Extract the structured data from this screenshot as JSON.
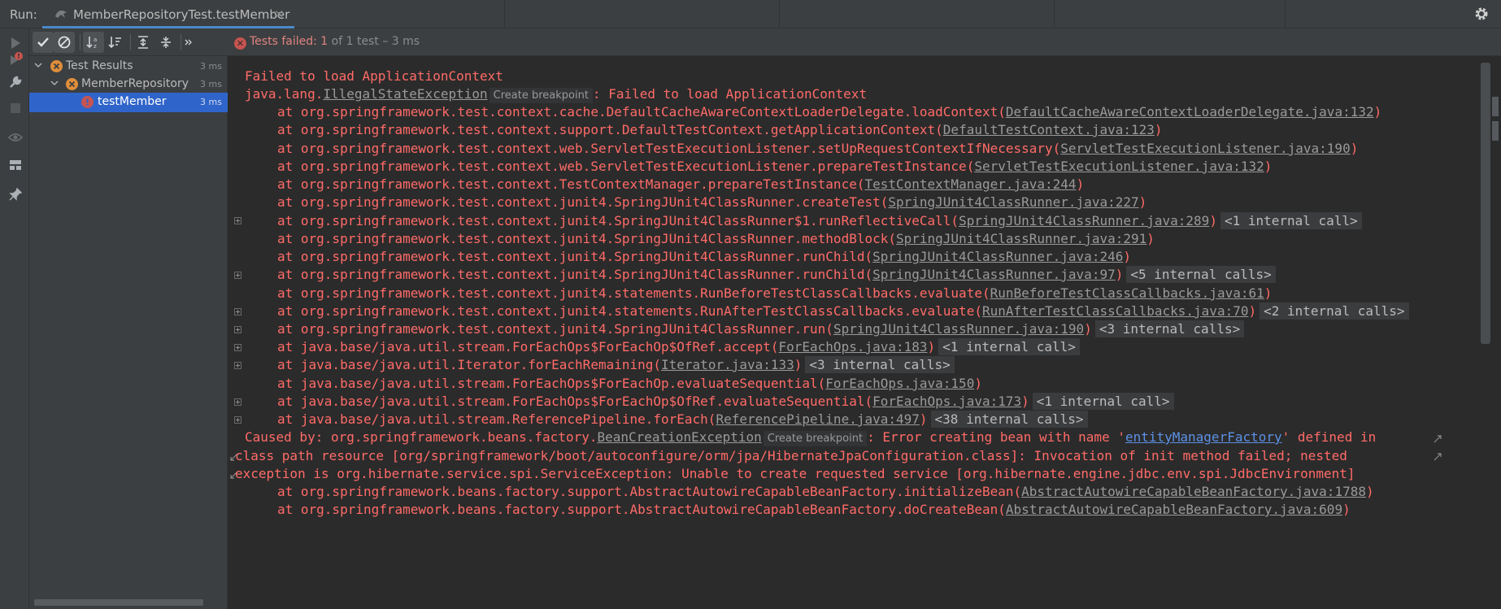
{
  "window": {
    "run_label": "Run:",
    "tab_title": "MemberRepositoryTest.testMember",
    "tab_close": "×"
  },
  "status": {
    "failed_text": "Tests failed:",
    "failed_count": "1",
    "rest": "of 1 test – 3 ms"
  },
  "tree": {
    "items": [
      {
        "label": "Test Results",
        "time": "3 ms"
      },
      {
        "label": "MemberRepository",
        "time": "3 ms"
      },
      {
        "label": "testMember",
        "time": "3 ms"
      }
    ]
  },
  "console": {
    "chip_breakpoint": "Create breakpoint",
    "lines": [
      {
        "text": "Failed to load ApplicationContext"
      },
      {
        "pre": "java.lang.",
        "link": "IllegalStateException",
        "post": ": Failed to load ApplicationContext"
      },
      {
        "pre": "at org.springframework.test.context.cache.DefaultCacheAwareContextLoaderDelegate.loadContext(",
        "link": "DefaultCacheAwareContextLoaderDelegate.java:132",
        "post": ")"
      },
      {
        "pre": "at org.springframework.test.context.support.DefaultTestContext.getApplicationContext(",
        "link": "DefaultTestContext.java:123",
        "post": ")"
      },
      {
        "pre": "at org.springframework.test.context.web.ServletTestExecutionListener.setUpRequestContextIfNecessary(",
        "link": "ServletTestExecutionListener.java:190",
        "post": ")"
      },
      {
        "pre": "at org.springframework.test.context.web.ServletTestExecutionListener.prepareTestInstance(",
        "link": "ServletTestExecutionListener.java:132",
        "post": ")"
      },
      {
        "pre": "at org.springframework.test.context.TestContextManager.prepareTestInstance(",
        "link": "TestContextManager.java:244",
        "post": ")"
      },
      {
        "pre": "at org.springframework.test.context.junit4.SpringJUnit4ClassRunner.createTest(",
        "link": "SpringJUnit4ClassRunner.java:227",
        "post": ")"
      },
      {
        "pre": "at org.springframework.test.context.junit4.SpringJUnit4ClassRunner$1.runReflectiveCall(",
        "link": "SpringJUnit4ClassRunner.java:289",
        "post": ")",
        "internal": "<1 internal call>"
      },
      {
        "pre": "at org.springframework.test.context.junit4.SpringJUnit4ClassRunner.methodBlock(",
        "link": "SpringJUnit4ClassRunner.java:291",
        "post": ")"
      },
      {
        "pre": "at org.springframework.test.context.junit4.SpringJUnit4ClassRunner.runChild(",
        "link": "SpringJUnit4ClassRunner.java:246",
        "post": ")"
      },
      {
        "pre": "at org.springframework.test.context.junit4.SpringJUnit4ClassRunner.runChild(",
        "link": "SpringJUnit4ClassRunner.java:97",
        "post": ")",
        "internal": "<5 internal calls>"
      },
      {
        "pre": "at org.springframework.test.context.junit4.statements.RunBeforeTestClassCallbacks.evaluate(",
        "link": "RunBeforeTestClassCallbacks.java:61",
        "post": ")"
      },
      {
        "pre": "at org.springframework.test.context.junit4.statements.RunAfterTestClassCallbacks.evaluate(",
        "link": "RunAfterTestClassCallbacks.java:70",
        "post": ")",
        "internal": "<2 internal calls>"
      },
      {
        "pre": "at org.springframework.test.context.junit4.SpringJUnit4ClassRunner.run(",
        "link": "SpringJUnit4ClassRunner.java:190",
        "post": ")",
        "internal": "<3 internal calls>"
      },
      {
        "pre": "at java.base/java.util.stream.ForEachOps$ForEachOp$OfRef.accept(",
        "link": "ForEachOps.java:183",
        "post": ")",
        "internal": "<1 internal call>"
      },
      {
        "pre": "at java.base/java.util.Iterator.forEachRemaining(",
        "link": "Iterator.java:133",
        "post": ")",
        "internal": "<3 internal calls>"
      },
      {
        "pre": "at java.base/java.util.stream.ForEachOps$ForEachOp.evaluateSequential(",
        "link": "ForEachOps.java:150",
        "post": ")"
      },
      {
        "pre": "at java.base/java.util.stream.ForEachOps$ForEachOp$OfRef.evaluateSequential(",
        "link": "ForEachOps.java:173",
        "post": ")",
        "internal": "<1 internal call>"
      },
      {
        "pre": "at java.base/java.util.stream.ReferencePipeline.forEach(",
        "link": "ReferencePipeline.java:497",
        "post": ")",
        "internal": "<38 internal calls>"
      },
      {
        "pre": "Caused by: org.springframework.beans.factory.",
        "link": "BeanCreationException",
        "mid": ": Error creating bean with name '",
        "hyper": "entityManagerFactory",
        "post": "' defined in"
      },
      {
        "text": "class path resource [org/springframework/boot/autoconfigure/orm/jpa/HibernateJpaConfiguration.class]: Invocation of init method failed; nested"
      },
      {
        "text": "exception is org.hibernate.service.spi.ServiceException: Unable to create requested service [org.hibernate.engine.jdbc.env.spi.JdbcEnvironment]"
      },
      {
        "pre": "at org.springframework.beans.factory.support.AbstractAutowireCapableBeanFactory.initializeBean(",
        "link": "AbstractAutowireCapableBeanFactory.java:1788",
        "post": ")"
      },
      {
        "pre": "at org.springframework.beans.factory.support.AbstractAutowireCapableBeanFactory.doCreateBean(",
        "link": "AbstractAutowireCapableBeanFactory.java:609",
        "post": ")"
      }
    ]
  },
  "colors": {
    "error_red": "#ff6b68",
    "accent_blue": "#2f65ca",
    "fail_icon": "#c75450"
  }
}
